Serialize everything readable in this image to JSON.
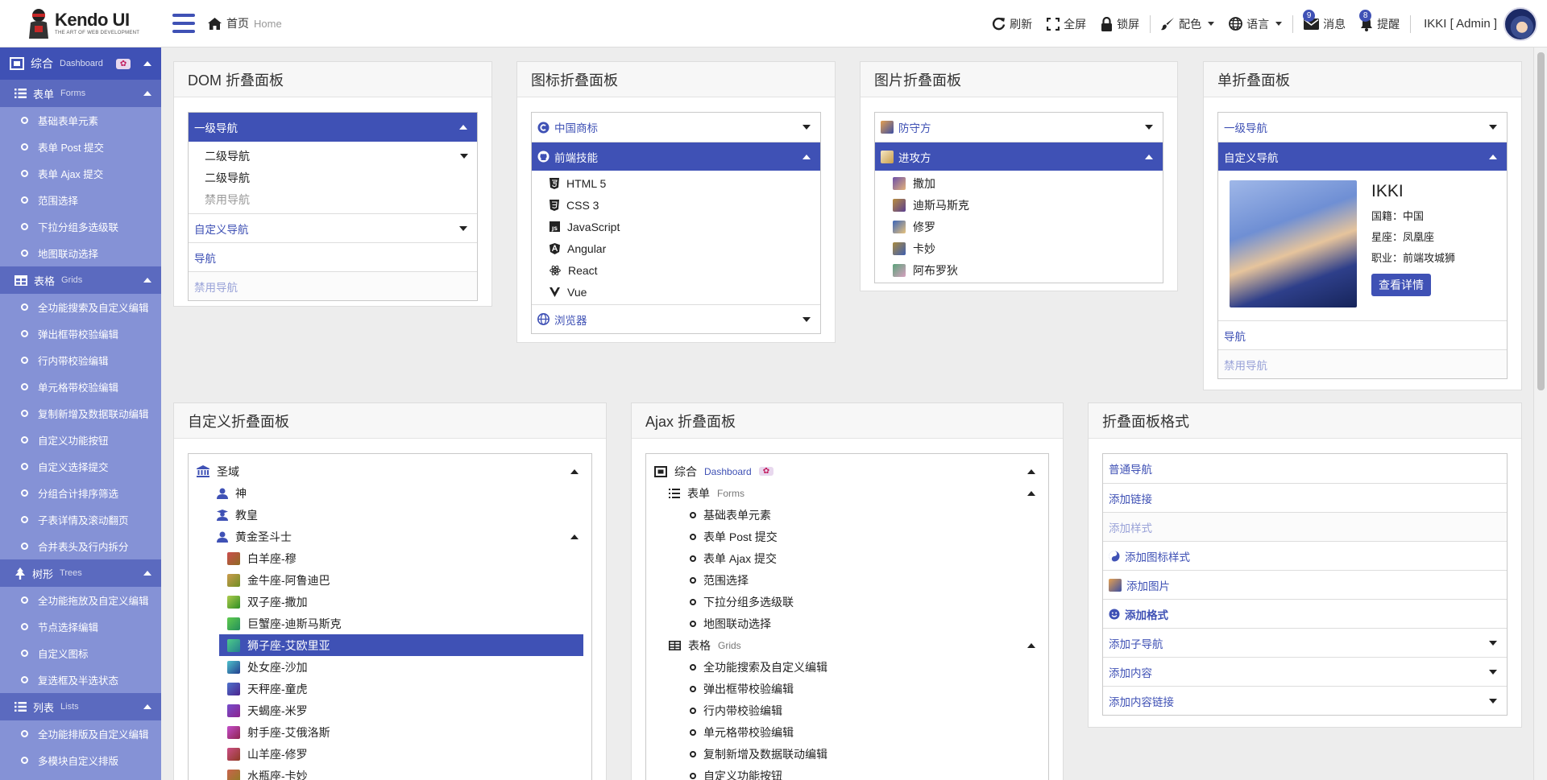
{
  "header": {
    "brand_title": "Kendo UI",
    "brand_tagline": "THE ART OF WEB DEVELOPMENT",
    "breadcrumb_home": "首页",
    "breadcrumb_home_en": "Home",
    "tools": {
      "refresh": "刷新",
      "fullscreen": "全屏",
      "lock": "锁屏",
      "theme": "配色",
      "language": "语言",
      "messages": "消息",
      "messages_count": "9",
      "reminders": "提醒",
      "reminders_count": "8"
    },
    "user": "IKKI [ Admin ]"
  },
  "sidebar": {
    "top": {
      "label": "综合",
      "en": "Dashboard",
      "flag": "✿"
    },
    "sections": [
      {
        "label": "表单",
        "en": "Forms",
        "icon": "list-icon",
        "items": [
          "基础表单元素",
          "表单 Post 提交",
          "表单 Ajax 提交",
          "范围选择",
          "下拉分组多选级联",
          "地图联动选择"
        ]
      },
      {
        "label": "表格",
        "en": "Grids",
        "icon": "table-icon",
        "items": [
          "全功能搜索及自定义编辑",
          "弹出框带校验编辑",
          "行内带校验编辑",
          "单元格带校验编辑",
          "复制新增及数据联动编辑",
          "自定义功能按钮",
          "自定义选择提交",
          "分组合计排序筛选",
          "子表详情及滚动翻页",
          "合并表头及行内拆分"
        ]
      },
      {
        "label": "树形",
        "en": "Trees",
        "icon": "tree-icon",
        "items": [
          "全功能拖放及自定义编辑",
          "节点选择编辑",
          "自定义图标",
          "复选框及半选状态"
        ]
      },
      {
        "label": "列表",
        "en": "Lists",
        "icon": "list-icon",
        "items": [
          "全功能排版及自定义编辑",
          "多模块自定义排版"
        ]
      }
    ]
  },
  "panels": {
    "dom": {
      "title": "DOM 折叠面板",
      "level1": "一级导航",
      "sub": [
        "二级导航",
        "二级导航",
        "禁用导航"
      ],
      "custom": "自定义导航",
      "nav": "导航",
      "disabled": "禁用导航"
    },
    "icon": {
      "title": "图标折叠面板",
      "brand": "中国商标",
      "frontend": "前端技能",
      "skills": [
        "HTML 5",
        "CSS 3",
        "JavaScript",
        "Angular",
        "React",
        "Vue"
      ],
      "browser": "浏览器"
    },
    "image": {
      "title": "图片折叠面板",
      "defense": "防守方",
      "attack": "进攻方",
      "members": [
        "撒加",
        "迪斯马斯克",
        "修罗",
        "卡妙",
        "阿布罗狄"
      ]
    },
    "single": {
      "title": "单折叠面板",
      "level1": "一级导航",
      "custom": "自定义导航",
      "card_name": "IKKI",
      "card_lines": [
        "国籍：中国",
        "星座：凤凰座",
        "职业：前端攻城狮"
      ],
      "card_button": "查看详情",
      "nav": "导航",
      "disabled": "禁用导航"
    },
    "custom": {
      "title": "自定义折叠面板",
      "root": "圣域",
      "children": [
        "神",
        "教皇",
        "黄金圣斗士"
      ],
      "gold": [
        "白羊座-穆",
        "金牛座-阿鲁迪巴",
        "双子座-撒加",
        "巨蟹座-迪斯马斯克",
        "狮子座-艾欧里亚",
        "处女座-沙加",
        "天秤座-童虎",
        "天蝎座-米罗",
        "射手座-艾俄洛斯",
        "山羊座-修罗",
        "水瓶座-卡妙"
      ],
      "highlighted_index": 4
    },
    "ajax": {
      "title": "Ajax 折叠面板",
      "top": "综合",
      "top_en": "Dashboard",
      "top_flag": "✿",
      "forms": "表单",
      "forms_en": "Forms",
      "forms_items": [
        "基础表单元素",
        "表单 Post 提交",
        "表单 Ajax 提交",
        "范围选择",
        "下拉分组多选级联",
        "地图联动选择"
      ],
      "grids": "表格",
      "grids_en": "Grids",
      "grids_items": [
        "全功能搜索及自定义编辑",
        "弹出框带校验编辑",
        "行内带校验编辑",
        "单元格带校验编辑",
        "复制新增及数据联动编辑",
        "自定义功能按钮"
      ]
    },
    "format": {
      "title": "折叠面板格式",
      "rows": [
        "普通导航",
        "添加链接",
        "添加样式",
        "添加图标样式",
        "添加图片",
        "添加格式",
        "添加子导航",
        "添加内容",
        "添加内容链接"
      ]
    }
  },
  "colors": {
    "primary": "#3f51b5",
    "sidebar": "#8592d6",
    "sidebar_section": "#5b6abf"
  }
}
